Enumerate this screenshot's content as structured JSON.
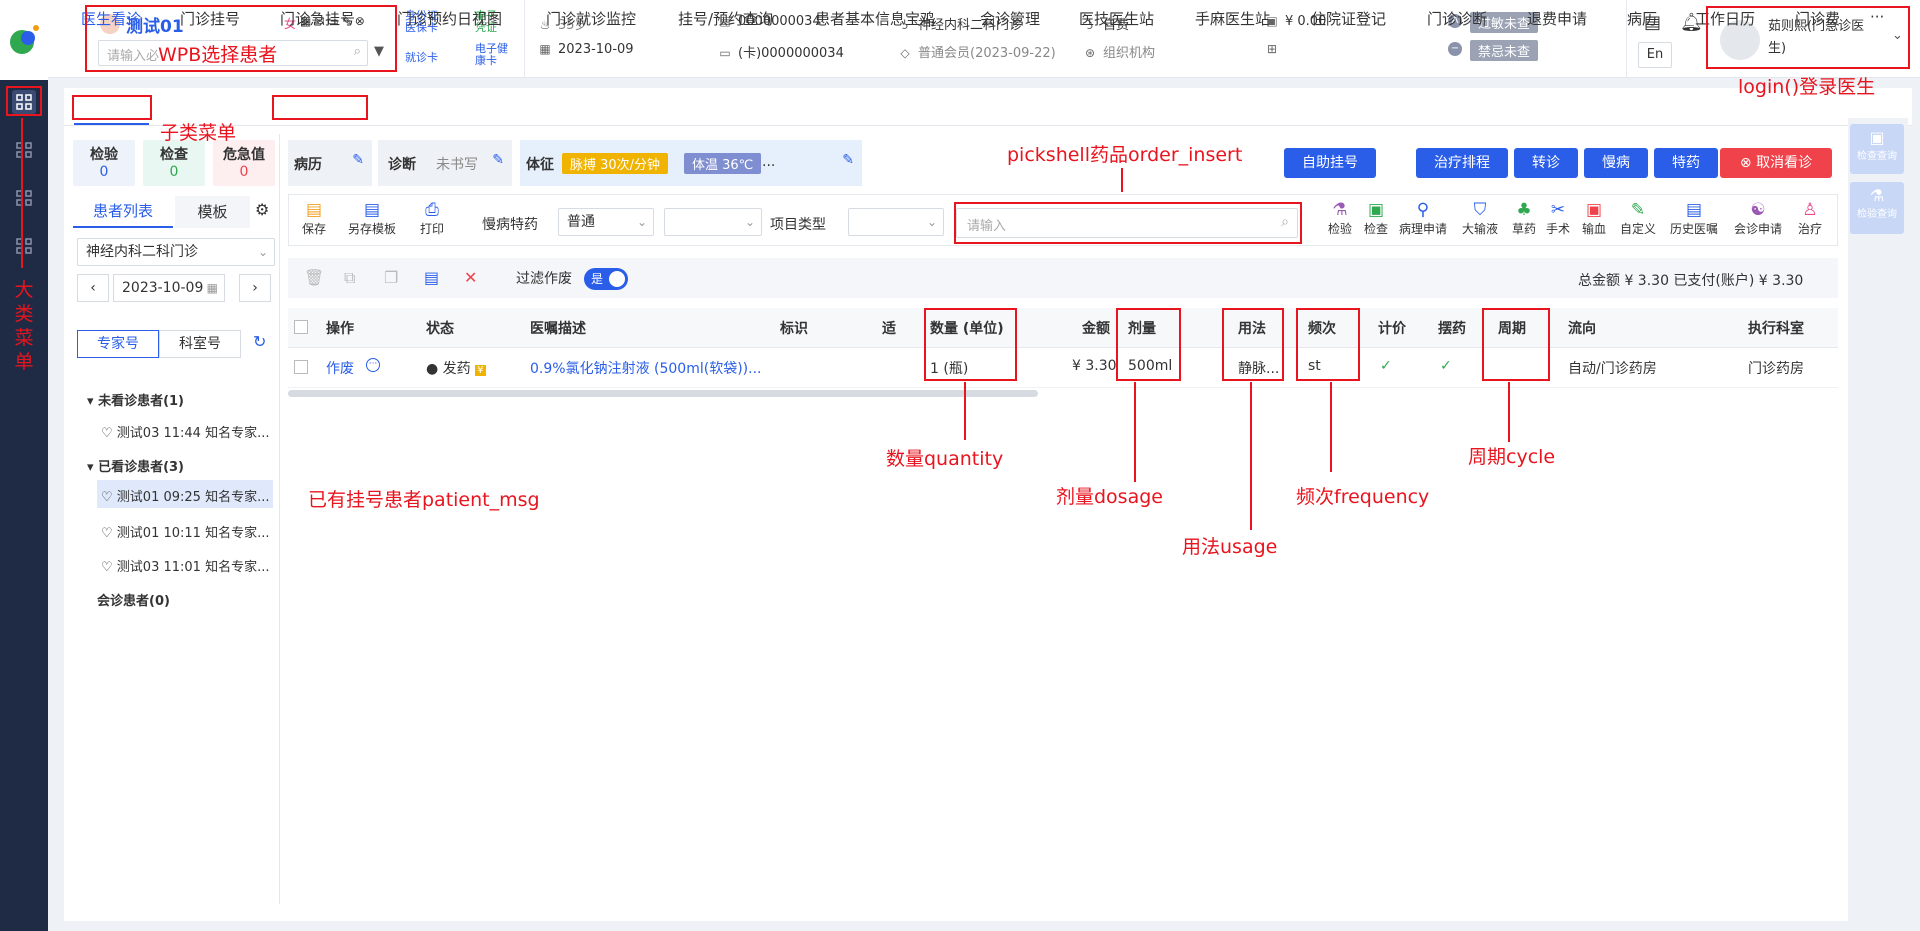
{
  "patient": {
    "name": "测试01",
    "gender_badge": "女",
    "search_placeholder": "请输入必",
    "age": "35岁",
    "visit_date": "2023-10-09",
    "id_no": "0000000034",
    "card_no": "(卡)0000000034",
    "department": "神经内科二科门诊",
    "membership": "普通会员(2023-09-22)",
    "fee_type": "自费",
    "org": "组织机构",
    "balance": "¥ 0.00",
    "allergy_label": "过敏未查",
    "taboo_label": "禁忌未查",
    "card_links": [
      "身份证",
      "医保卡",
      "电子凭证",
      "就诊卡",
      "电子健康卡"
    ]
  },
  "header": {
    "lang": "En",
    "doctor_name": "茹则熙(门急诊医生)"
  },
  "sidebar": {
    "vertical_label": [
      "大",
      "类",
      "菜",
      "单"
    ]
  },
  "tabs": [
    "医生看诊",
    "门诊挂号",
    "门诊急挂号",
    "门诊预约日视图",
    "门诊就诊监控",
    "挂号/预约查询",
    "患者基本信息宝鸡",
    "会诊管理",
    "医技医生站",
    "手麻医生站",
    "住院证登记",
    "门诊诊断",
    "退费申请",
    "病历",
    "工作日历",
    "门诊费用",
    "···"
  ],
  "stats": [
    {
      "label": "检验",
      "value": "0"
    },
    {
      "label": "检查",
      "value": "0"
    },
    {
      "label": "危急值",
      "value": "0"
    }
  ],
  "leftpanel": {
    "tab_patients": "患者列表",
    "tab_template": "模板",
    "dept_select": "神经内科二科门诊",
    "date": "2023-10-09",
    "btn_expert": "专家号",
    "btn_room": "科室号",
    "group_unseen": "未看诊患者(1)",
    "unseen": [
      "测试03 11:44 知名专家..."
    ],
    "group_seen": "已看诊患者(3)",
    "seen": [
      "测试01 09:25 知名专家...",
      "测试01 10:11 知名专家...",
      "测试03 11:01 知名专家..."
    ],
    "group_consult": "会诊患者(0)"
  },
  "summary": {
    "record": "病历",
    "diagnosis": "诊断",
    "diagnosis_value": "未书写",
    "vitals": "体征",
    "pulse": "脉搏 30次/分钟",
    "temp": "体温 36℃",
    "more": "..."
  },
  "actions": [
    "自助挂号",
    "治疗排程",
    "转诊",
    "慢病",
    "特药",
    "取消看诊"
  ],
  "toolbar": {
    "save": "保存",
    "save_template": "另存模板",
    "print": "打印",
    "chronic_label": "慢病特药",
    "chronic_value": "普通",
    "item_type_label": "项目类型",
    "search_placeholder": "请输入"
  },
  "order_tools": [
    "检验",
    "检查",
    "病理申请",
    "大输液",
    "草药",
    "手术",
    "输血",
    "自定义",
    "历史医嘱",
    "会诊申请",
    "治疗"
  ],
  "subtoolbar": {
    "filter_label": "过滤作废",
    "toggle_text": "是",
    "total": "总金额 ¥ 3.30 已支付(账户) ¥ 3.30"
  },
  "table": {
    "headers": [
      "操作",
      "状态",
      "医嘱描述",
      "标识",
      "适",
      "数量 (单位)",
      "金额",
      "剂量",
      "用法",
      "频次",
      "计价",
      "摆药",
      "周期",
      "流向",
      "执行科室"
    ],
    "rows": [
      {
        "op": "作废",
        "status": "发药",
        "desc": "0.9%氯化钠注射液 (500ml(软袋))...",
        "qty": "1 (瓶)",
        "amount": "¥ 3.30",
        "dosage": "500ml",
        "usage": "静脉...",
        "freq": "st",
        "cycle": "",
        "flow": "自动/门诊药房",
        "dept": "门诊药房"
      }
    ]
  },
  "right_strip": [
    "检查查询",
    "检验查询"
  ],
  "annotations": {
    "wpb": "WPB选择患者",
    "login": "login()登录医生",
    "submenu": "子类菜单",
    "pickshell": "pickshell药品order_insert",
    "patient_msg": "已有挂号患者patient_msg",
    "quantity": "数量quantity",
    "dosage": "剂量dosage",
    "usage": "用法usage",
    "frequency": "频次frequency",
    "cycle": "周期cycle"
  },
  "colors": {
    "primary": "#2a5ee8",
    "annotation": "#e8141e",
    "sidebar": "#1f2a44",
    "danger": "#f0424a",
    "check": "#2fa84f"
  }
}
